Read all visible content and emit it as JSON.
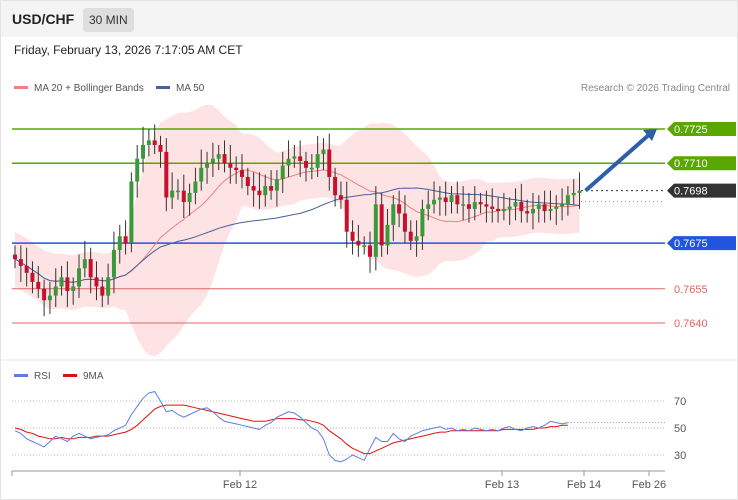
{
  "header": {
    "symbol": "USD/CHF",
    "timeframe": "30 MIN"
  },
  "datetime": "Friday, February 13, 2026 7:17:05 AM CET",
  "copyright": "Research © 2026 Trading Central",
  "colors": {
    "resistance": "#5aa700",
    "pivot": "#2255dd",
    "support": "#e06666",
    "last": "#333333",
    "bullish": "#3a9a3a",
    "bearish": "#c8102e",
    "band": "#fde3e3",
    "ma20": "#f08080",
    "ma50": "#4a5fa0",
    "rsi": "#5b7fe0",
    "rsi_ma": "#e01010",
    "arrow": "#2e5ea8"
  },
  "chart_data": [
    {
      "type": "candlestick",
      "pair": "USD/CHF",
      "timeframe": "30 MIN",
      "legend": [
        "MA 20 + Bollinger Bands",
        "MA 50"
      ],
      "ylim": [
        0.762,
        0.7755
      ],
      "levels": [
        {
          "value": 0.7725,
          "label": "0.7725",
          "kind": "resistance"
        },
        {
          "value": 0.771,
          "label": "0.7710",
          "kind": "resistance"
        },
        {
          "value": 0.7698,
          "label": "0.7698",
          "kind": "last"
        },
        {
          "value": 0.7675,
          "label": "0.7675",
          "kind": "pivot"
        },
        {
          "value": 0.7655,
          "label": "0.7655",
          "kind": "support"
        },
        {
          "value": 0.764,
          "label": "0.7640",
          "kind": "support"
        }
      ],
      "closes": [
        0.7668,
        0.7665,
        0.7662,
        0.7658,
        0.7655,
        0.765,
        0.7652,
        0.7656,
        0.766,
        0.7654,
        0.7656,
        0.7664,
        0.7668,
        0.766,
        0.7656,
        0.7652,
        0.766,
        0.7672,
        0.7678,
        0.7675,
        0.7702,
        0.7712,
        0.7718,
        0.772,
        0.7718,
        0.7715,
        0.7695,
        0.7698,
        0.7698,
        0.7693,
        0.7697,
        0.7702,
        0.7708,
        0.771,
        0.7712,
        0.7714,
        0.771,
        0.7708,
        0.7707,
        0.7704,
        0.77,
        0.7698,
        0.7696,
        0.77,
        0.7698,
        0.7703,
        0.7709,
        0.7712,
        0.7713,
        0.7711,
        0.7708,
        0.7708,
        0.7714,
        0.7716,
        0.7704,
        0.7696,
        0.7694,
        0.768,
        0.7676,
        0.7674,
        0.7674,
        0.7669,
        0.7692,
        0.7674,
        0.7683,
        0.7692,
        0.7688,
        0.768,
        0.7676,
        0.7678,
        0.769,
        0.7692,
        0.7694,
        0.7695,
        0.7693,
        0.7696,
        0.7692,
        0.7692,
        0.769,
        0.7693,
        0.7692,
        0.7691,
        0.769,
        0.7689,
        0.769,
        0.7691,
        0.7693,
        0.7689,
        0.7688,
        0.769,
        0.7692,
        0.7689,
        0.769,
        0.7691,
        0.7692,
        0.7696,
        0.7697,
        0.7698
      ]
    },
    {
      "type": "line",
      "legend": [
        "RSI",
        "9MA"
      ],
      "ylim": [
        20,
        80
      ],
      "ticks": [
        70,
        50,
        30
      ],
      "x_ticks": [
        "Feb 12",
        "Feb 13",
        "Feb 14",
        "Feb 26"
      ],
      "series": [
        {
          "name": "RSI",
          "values": [
            48,
            46,
            42,
            40,
            38,
            36,
            40,
            44,
            42,
            40,
            44,
            46,
            44,
            42,
            43,
            44,
            45,
            48,
            50,
            52,
            60,
            66,
            72,
            76,
            77,
            70,
            62,
            63,
            60,
            58,
            60,
            62,
            64,
            65,
            62,
            58,
            55,
            54,
            53,
            52,
            51,
            50,
            49,
            52,
            54,
            58,
            60,
            62,
            61,
            58,
            54,
            50,
            48,
            42,
            30,
            26,
            25,
            27,
            30,
            28,
            26,
            35,
            43,
            40,
            40,
            46,
            42,
            40,
            44,
            46,
            48,
            49,
            50,
            51,
            49,
            50,
            48,
            49,
            48,
            50,
            49,
            48,
            49,
            48,
            50,
            51,
            49,
            48,
            50,
            51,
            50,
            52,
            55,
            54,
            53,
            54
          ]
        },
        {
          "name": "9MA",
          "values": [
            50,
            49,
            47,
            46,
            44,
            43,
            42,
            42,
            43,
            42,
            42,
            43,
            43,
            43,
            44,
            44,
            44,
            45,
            46,
            47,
            49,
            52,
            56,
            60,
            64,
            66,
            67,
            67,
            67,
            67,
            66,
            65,
            64,
            63,
            62,
            61,
            60,
            59,
            58,
            57,
            56,
            55,
            55,
            55,
            56,
            57,
            57,
            57,
            57,
            56,
            56,
            55,
            54,
            52,
            48,
            45,
            42,
            38,
            35,
            33,
            31,
            31,
            33,
            35,
            37,
            39,
            40,
            41,
            42,
            43,
            44,
            45,
            46,
            47,
            47,
            48,
            48,
            48,
            48,
            48,
            48,
            48,
            48,
            48,
            49,
            49,
            49,
            49,
            49,
            49,
            50,
            50,
            51,
            51,
            52,
            52
          ]
        }
      ]
    }
  ]
}
